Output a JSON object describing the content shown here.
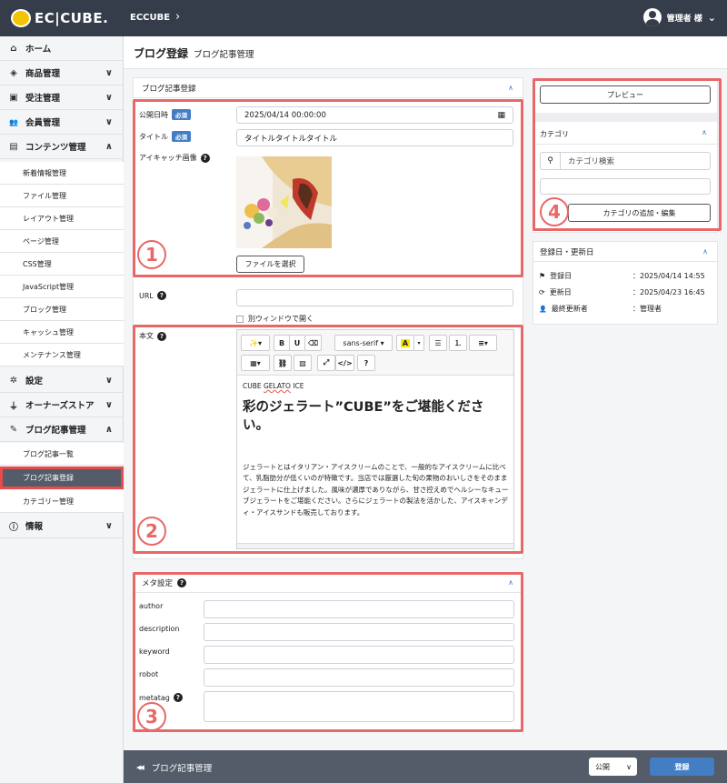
{
  "header": {
    "logo_text": "EC|CUBE.",
    "shop_name": "ECCUBE",
    "shop_chevron": "›",
    "user_name": "管理者 様",
    "user_chevron": "⌄"
  },
  "sidebar": {
    "items": [
      {
        "label": "ホーム",
        "icon": "home-icon",
        "glyph": "⌂",
        "chevron": ""
      },
      {
        "label": "商品管理",
        "icon": "cube-icon",
        "glyph": "◈",
        "chevron": "∨"
      },
      {
        "label": "受注管理",
        "icon": "cart-icon",
        "glyph": "▣",
        "chevron": "∨"
      },
      {
        "label": "会員管理",
        "icon": "users-icon",
        "glyph": "👥",
        "chevron": "∨"
      },
      {
        "label": "コンテンツ管理",
        "icon": "file-icon",
        "glyph": "▤",
        "chevron": "∧"
      },
      {
        "label": "新着情報管理"
      },
      {
        "label": "ファイル管理"
      },
      {
        "label": "レイアウト管理"
      },
      {
        "label": "ページ管理"
      },
      {
        "label": "CSS管理"
      },
      {
        "label": "JavaScript管理"
      },
      {
        "label": "ブロック管理"
      },
      {
        "label": "キャッシュ管理"
      },
      {
        "label": "メンテナンス管理"
      },
      {
        "label": "設定",
        "icon": "gear-icon",
        "glyph": "✲",
        "chevron": "∨"
      },
      {
        "label": "オーナーズストア",
        "icon": "plug-icon",
        "glyph": "⏚",
        "chevron": "∨"
      },
      {
        "label": "ブログ記事管理",
        "icon": "pen-icon",
        "glyph": "✎",
        "chevron": "∧"
      },
      {
        "label": "ブログ記事一覧"
      },
      {
        "label": "ブログ記事登録"
      },
      {
        "label": "カテゴリー管理"
      },
      {
        "label": "情報",
        "icon": "info-icon",
        "glyph": "ⓘ",
        "chevron": "∨"
      }
    ]
  },
  "page": {
    "title": "ブログ登録",
    "subtitle": "ブログ記事管理"
  },
  "main_card": {
    "title": "ブログ記事登録",
    "caret": "∧",
    "publish_label": "公開日時",
    "required_badge": "必須",
    "publish_value": "2025/04/14  00:00:00",
    "calendar_icon": "calendar-icon",
    "calendar_glyph": "▦",
    "title_label": "タイトル",
    "title_value": "タイトルタイトルタイトル",
    "eyecatch_label": "アイキャッチ画像",
    "file_button": "ファイルを選択",
    "url_label": "URL",
    "new_window_label": "別ウィンドウで開く",
    "body_label": "本文",
    "help_glyph": "?"
  },
  "editor": {
    "toolbar": {
      "magic": "✨▾",
      "bold": "B",
      "underline": "U",
      "eraser": "⌫",
      "font": "sans-serif ▾",
      "color_a": "A",
      "color_caret": "▾",
      "ul": "☰",
      "ol": "⒈",
      "align": "≡▾",
      "table": "▦▾",
      "link": "⛓",
      "image": "▨",
      "fullscreen": "⤢",
      "code": "</>",
      "help": "?"
    },
    "line1_a": "CUBE ",
    "line1_b": "GELATO",
    "line1_c": " ICE",
    "heading": "彩のジェラート”CUBE”をご堪能ください。",
    "paragraph": "ジェラートとはイタリアン・アイスクリームのことで、一般的なアイスクリームに比べて、乳脂肪分が低くいのが特徴です。当店では厳選した旬の果物のおいしさをそのままジェラートに仕上げました。風味が濃厚でありながら、甘さ控えめでヘルシーなキューブジェラートをご堪能ください。さらにジェラートの製法を活かした、アイスキャンディ・アイスサンドも販売しております。"
  },
  "meta_card": {
    "title": "メタ設定",
    "caret": "∧",
    "fields": [
      "author",
      "description",
      "keyword",
      "robot",
      "metatag"
    ]
  },
  "right_panel": {
    "preview_button": "プレビュー",
    "category_title": "カテゴリ",
    "category_caret": "∧",
    "search_placeholder": "カテゴリ検索",
    "category_edit_button": "カテゴリの追加・編集"
  },
  "dates_card": {
    "title": "登録日・更新日",
    "caret": "∧",
    "rows": [
      {
        "icon": "flag-icon",
        "glyph": "⚑",
        "label": "登録日",
        "value": "：2025/04/14 14:55"
      },
      {
        "icon": "refresh-icon",
        "glyph": "⟳",
        "label": "更新日",
        "value": "：2025/04/23 16:45"
      },
      {
        "icon": "person-icon",
        "glyph": "👤",
        "label": "最終更新者",
        "value": "：管理者"
      }
    ]
  },
  "annotations": {
    "n1": "1",
    "n2": "2",
    "n3": "3",
    "n4": "4"
  },
  "footer": {
    "back_glyph": "◀◀",
    "back_label": "ブログ記事管理",
    "status_value": "公開",
    "status_chevron": "∨",
    "save_label": "登録"
  },
  "colors": {
    "topbar": "#353d4a",
    "accent": "#437ec4",
    "annotation_red": "#e86868"
  }
}
